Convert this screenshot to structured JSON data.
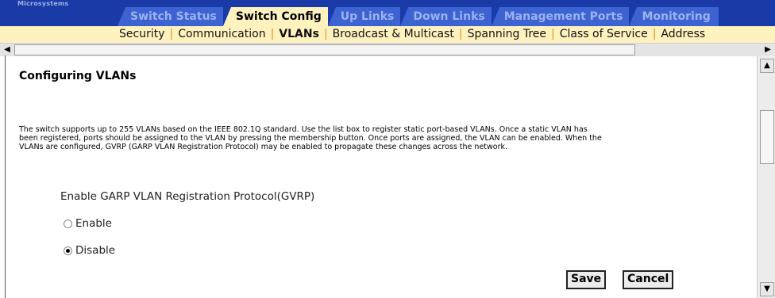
{
  "header": {
    "logo_text": "Microsystems",
    "tabs": [
      {
        "label": "Switch Status",
        "active": false
      },
      {
        "label": "Switch Config",
        "active": true
      },
      {
        "label": "Up Links",
        "active": false
      },
      {
        "label": "Down Links",
        "active": false
      },
      {
        "label": "Management Ports",
        "active": false
      },
      {
        "label": "Monitoring",
        "active": false
      }
    ]
  },
  "subnav": {
    "items": [
      "Security",
      "Communication",
      "VLANs",
      "Broadcast & Multicast",
      "Spanning Tree",
      "Class of Service",
      "Address"
    ],
    "current": "VLANs",
    "separator": "|"
  },
  "page": {
    "title": "Configuring VLANs",
    "description": "The switch supports up to 255 VLANs based on the IEEE 802.1Q standard. Use the list box to register static port-based VLANs. Once a static VLAN has been registered, ports should be assigned to the VLAN by pressing the membership button. Once ports are assigned, the VLAN can be enabled. When the VLANs are configured, GVRP (GARP VLAN Registration Protocol) may be enabled to propagate these changes across the network.",
    "gvrp_label": "Enable GARP VLAN Registration Protocol(GVRP)",
    "options": [
      {
        "label": "Enable",
        "selected": false
      },
      {
        "label": "Disable",
        "selected": true
      }
    ],
    "save_label": "Save",
    "cancel_label": "Cancel"
  },
  "colors": {
    "tab_bar": "#1a3aa8",
    "tab_inactive": "#3d62d2",
    "tab_active": "#fff2bf",
    "separator": "#d79b1a"
  }
}
